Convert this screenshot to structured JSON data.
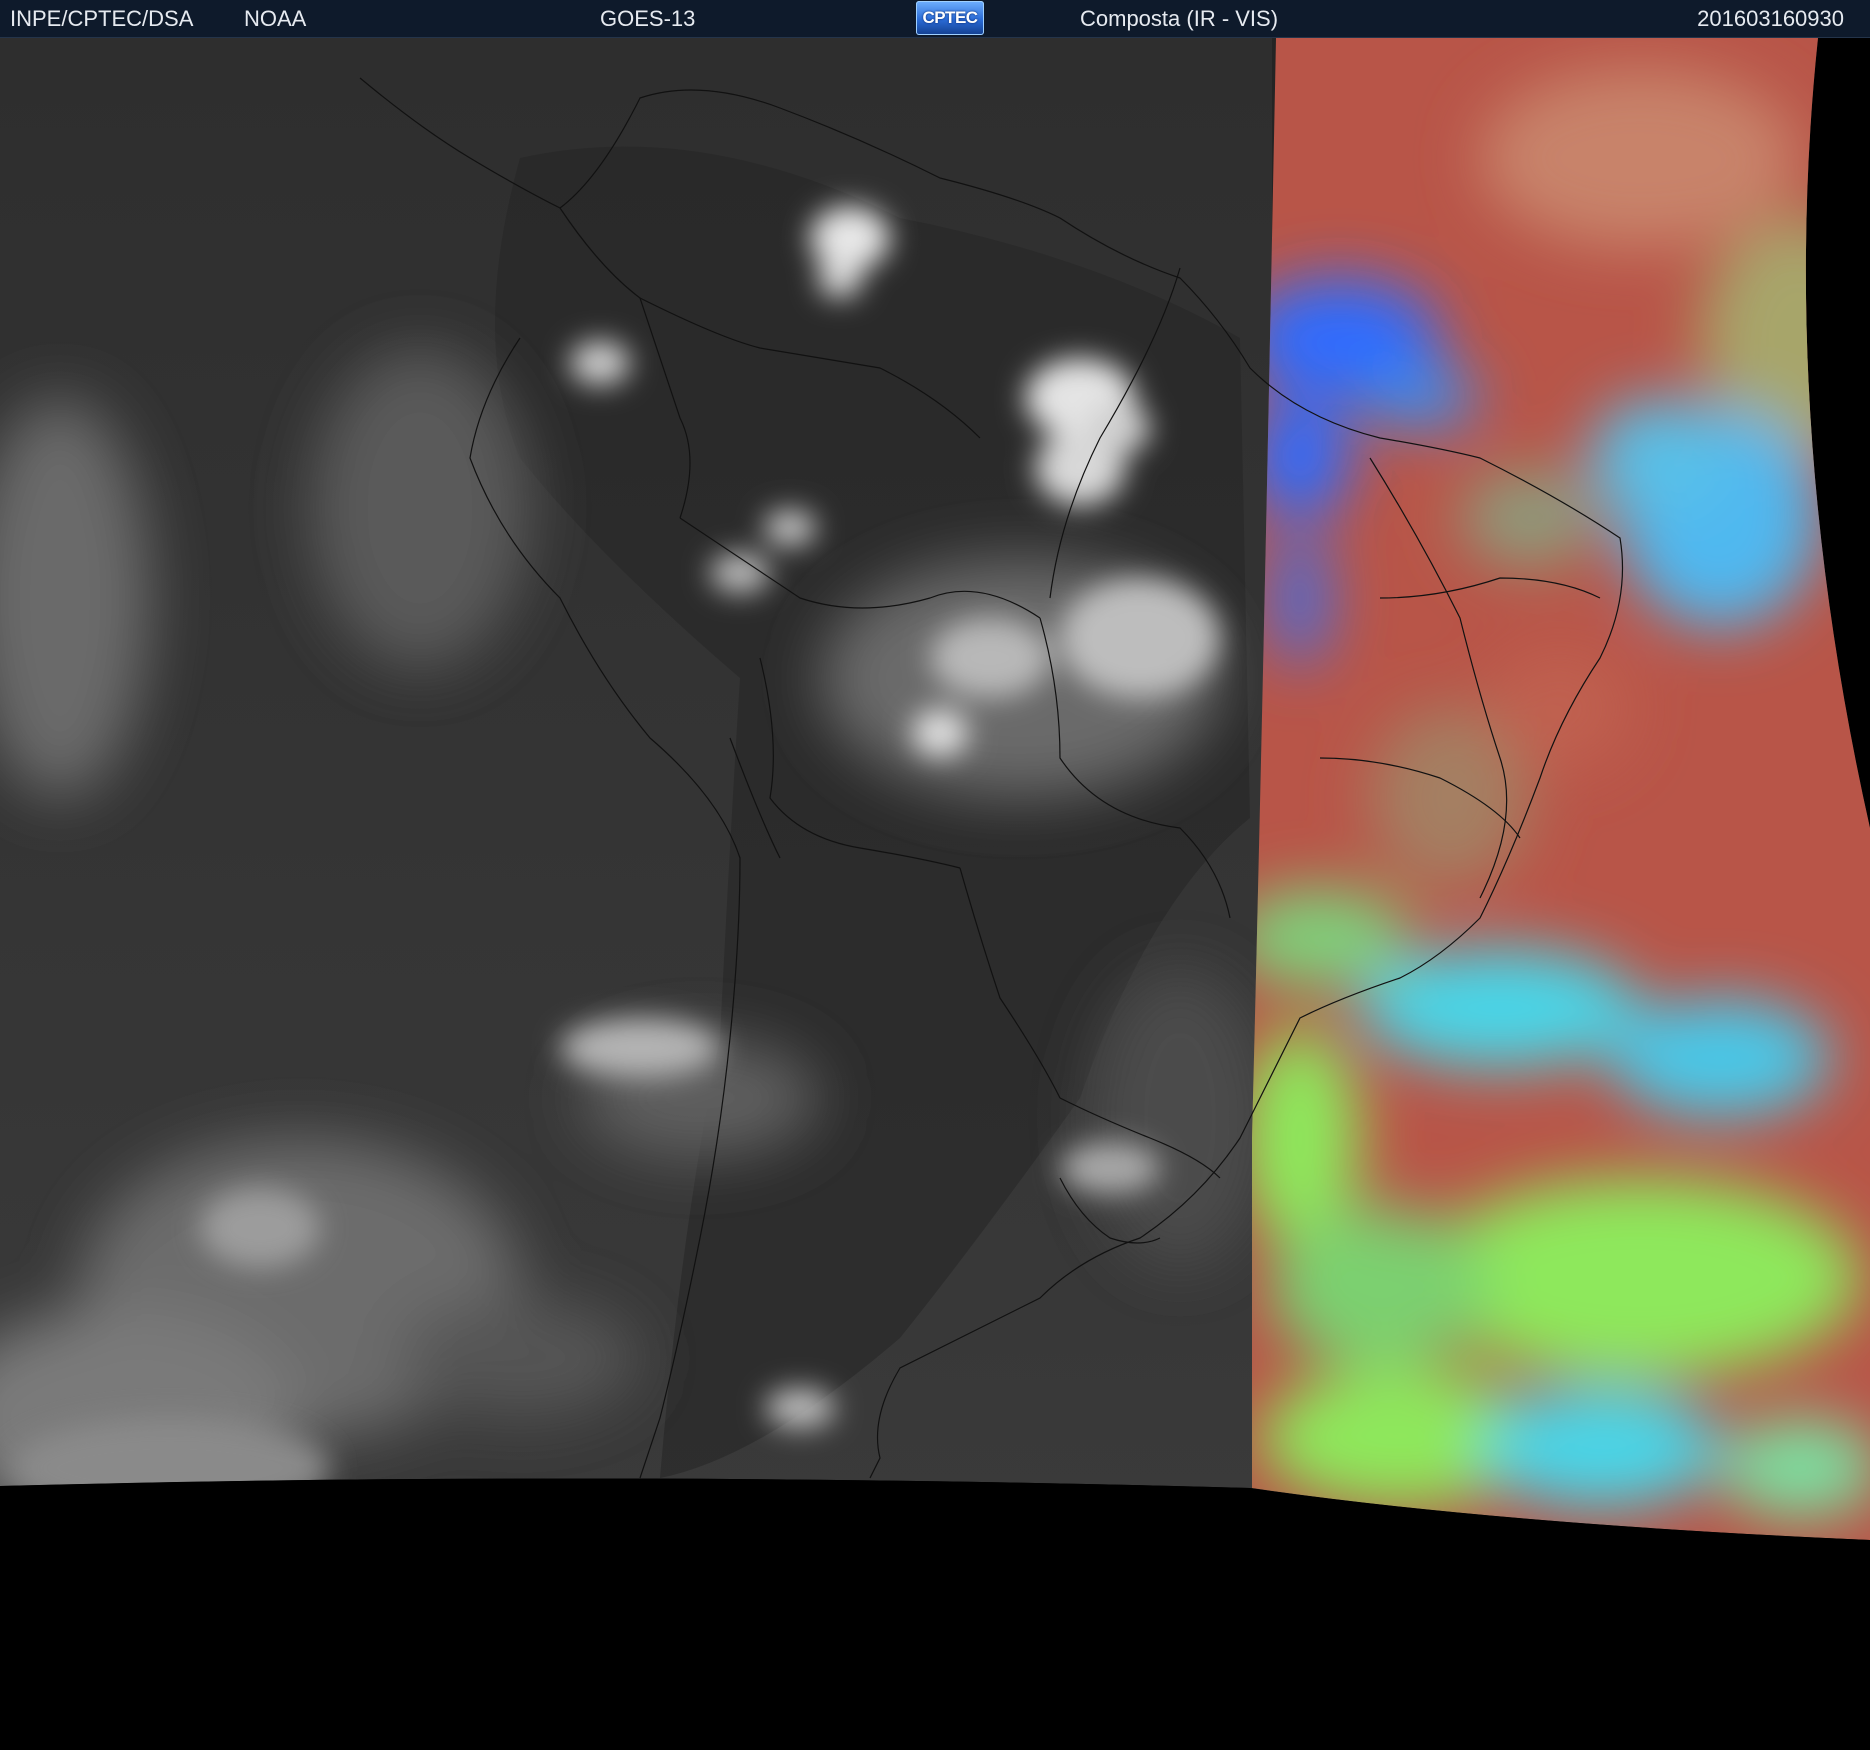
{
  "header": {
    "org": "INPE/CPTEC/DSA",
    "agency": "NOAA",
    "satellite": "GOES-13",
    "logo_text": "CPTEC",
    "product": "Composta (IR - VIS)",
    "timestamp": "201603160930"
  },
  "colors": {
    "header_bg": "#0e1a2b",
    "ir_dark": "#303030",
    "ir_cloud": "#dcdcdc",
    "vis_base": "#b85548",
    "vis_blue": "#2f6cff",
    "vis_cyan": "#49d6e8",
    "vis_green": "#8ee85c",
    "space": "#000000",
    "border_lines": "#111111"
  },
  "icons": {
    "logo": "cptec-logo-icon"
  }
}
